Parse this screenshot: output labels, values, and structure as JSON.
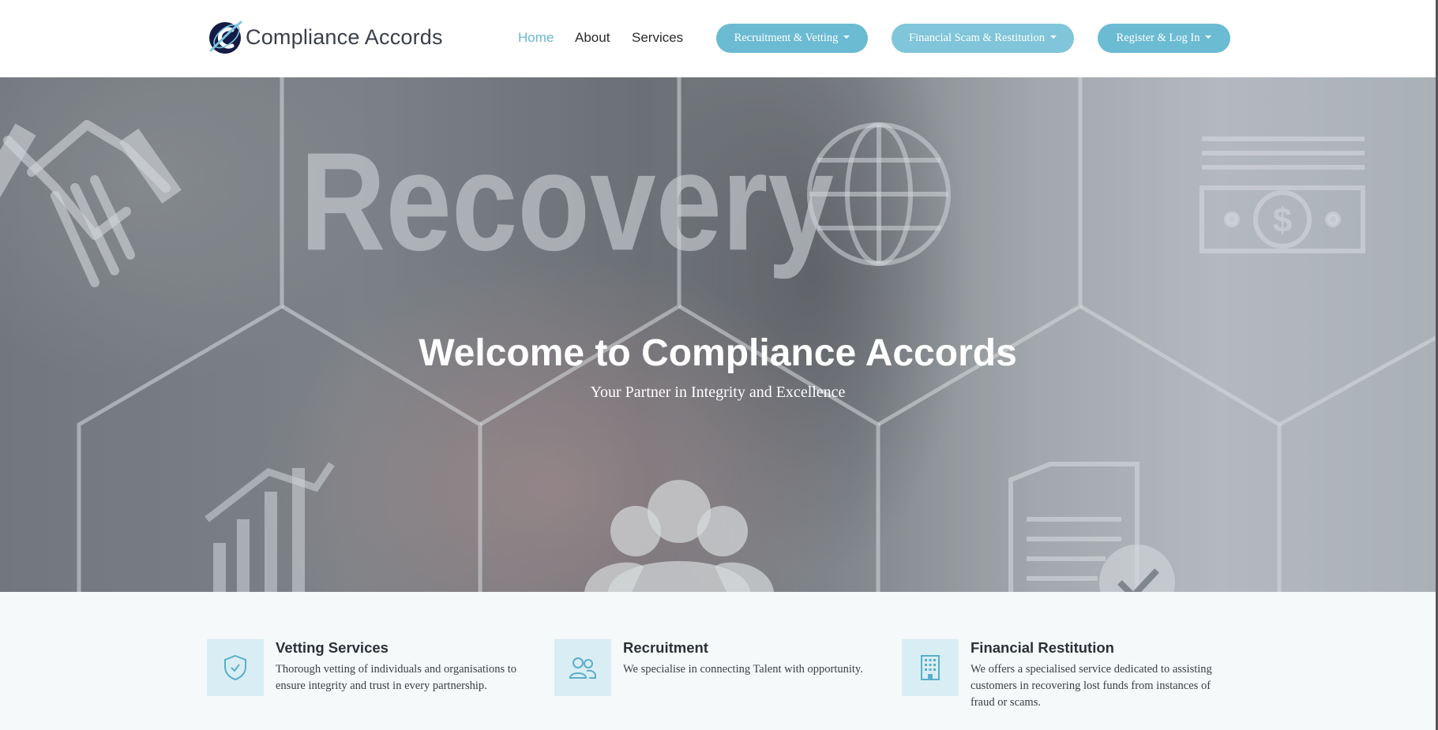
{
  "brand": {
    "name": "Compliance Accords",
    "logo_icon": "c-swoosh-logo"
  },
  "nav": {
    "links": [
      {
        "label": "Home",
        "active": true
      },
      {
        "label": "About",
        "active": false
      },
      {
        "label": "Services",
        "active": false
      }
    ],
    "dropdowns": [
      {
        "label": "Recruitment & Vetting"
      },
      {
        "label": "Financial Scam & Restitution"
      },
      {
        "label": "Register & Log In"
      }
    ]
  },
  "hero": {
    "title": "Welcome to Compliance Accords",
    "subtitle": "Your Partner in Integrity and Excellence",
    "background_word": "Recovery"
  },
  "features": [
    {
      "icon": "shield-check-icon",
      "title": "Vetting Services",
      "description": "Thorough vetting of individuals and organisations to ensure integrity and trust in every partnership."
    },
    {
      "icon": "users-icon",
      "title": "Recruitment",
      "description": "We specialise in connecting Talent with opportunity."
    },
    {
      "icon": "building-icon",
      "title": "Financial Restitution",
      "description": "We offers a specialised service dedicated to assisting customers in recovering lost funds from instances of fraud or scams."
    }
  ],
  "colors": {
    "accent": "#6bbbd2",
    "nav_active": "#6bb7cf",
    "feature_bg": "#f5f9fa",
    "icon_box": "#d9eef4"
  }
}
